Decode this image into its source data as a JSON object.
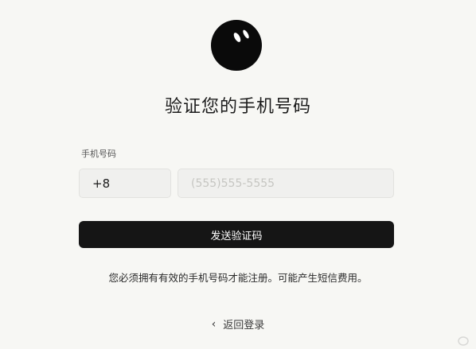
{
  "page": {
    "title": "验证您的手机号码"
  },
  "form": {
    "phone_label": "手机号码",
    "country_code_value": "+8",
    "phone_placeholder": "(555)555-5555",
    "send_button_label": "发送验证码",
    "notice_text": "您必须拥有有效的手机号码才能注册。可能产生短信费用。",
    "back_label": "返回登录"
  },
  "icons": {
    "logo": "logo-icon",
    "back": "chevron-left-icon"
  },
  "colors": {
    "button_bg": "#151515",
    "page_bg": "#f7f7f4"
  }
}
